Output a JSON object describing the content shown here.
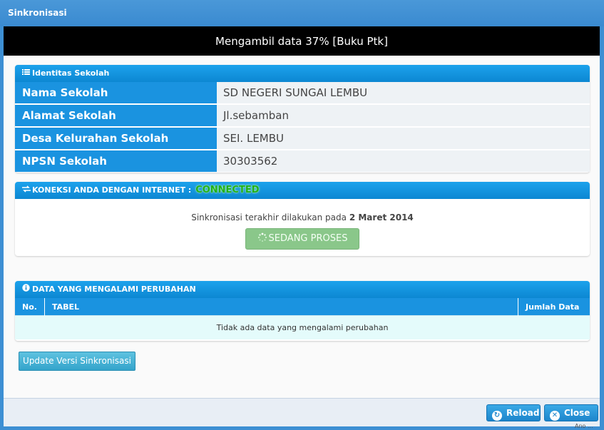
{
  "window": {
    "title": "Sinkronisasi"
  },
  "progress": {
    "text": "Mengambil data 37% [Buku Ptk]",
    "percent": 37
  },
  "identitas": {
    "title": "Identitas Sekolah",
    "icon": "list-icon",
    "rows": [
      {
        "label": "Nama Sekolah",
        "value": "SD NEGERI SUNGAI LEMBU"
      },
      {
        "label": "Alamat Sekolah",
        "value": "Jl.sebamban"
      },
      {
        "label": "Desa Kelurahan Sekolah",
        "value": "SEI. LEMBU"
      },
      {
        "label": "NPSN Sekolah",
        "value": "30303562"
      }
    ]
  },
  "koneksi": {
    "title": "KONEKSI ANDA DENGAN INTERNET :",
    "status": "CONNECTED",
    "status_color": "#1fb01a",
    "icon": "exchange-icon",
    "last_sync_text": "Sinkronisasi terakhir dilakukan pada",
    "last_sync_date": "2 Maret 2014",
    "process_button": "SEDANG PROSES",
    "process_icon": "spinner-icon"
  },
  "perubahan": {
    "title": "DATA YANG MENGALAMI PERUBAHAN",
    "icon": "info-icon",
    "columns": [
      "No.",
      "TABEL",
      "Jumlah Data"
    ],
    "empty_message": "Tidak ada data yang mengalami perubahan"
  },
  "update_button": "Update Versi Sinkronisasi",
  "footer": {
    "reload": "Reload",
    "reload_icon": "refresh-icon",
    "close": "Close",
    "close_icon": "close-icon"
  },
  "edge_text": "Ano ..."
}
